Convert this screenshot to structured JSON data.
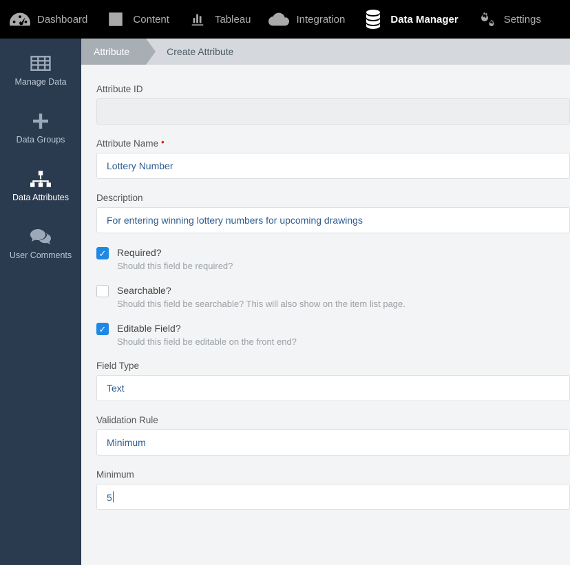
{
  "topnav": {
    "items": [
      {
        "label": "Dashboard",
        "icon": "gauge-icon",
        "active": false
      },
      {
        "label": "Content",
        "icon": "list-box-icon",
        "active": false
      },
      {
        "label": "Tableau",
        "icon": "bar-chart-icon",
        "active": false
      },
      {
        "label": "Integration",
        "icon": "cloud-icon",
        "active": false
      },
      {
        "label": "Data Manager",
        "icon": "database-icon",
        "active": true
      },
      {
        "label": "Settings",
        "icon": "gears-icon",
        "active": false
      }
    ]
  },
  "sidebar": {
    "items": [
      {
        "label": "Manage Data",
        "icon": "grid-icon",
        "active": false
      },
      {
        "label": "Data Groups",
        "icon": "plus-icon",
        "active": false
      },
      {
        "label": "Data Attributes",
        "icon": "hierarchy-icon",
        "active": true
      },
      {
        "label": "User Comments",
        "icon": "comments-icon",
        "active": false
      }
    ]
  },
  "breadcrumb": {
    "first": "Attribute",
    "second": "Create Attribute"
  },
  "form": {
    "attribute_id": {
      "label": "Attribute ID",
      "value": ""
    },
    "attribute_name": {
      "label": "Attribute Name",
      "required": true,
      "value": "Lottery Number"
    },
    "description": {
      "label": "Description",
      "value": "For entering winning lottery numbers for upcoming drawings"
    },
    "required": {
      "label": "Required?",
      "desc": "Should this field be required?",
      "checked": true
    },
    "searchable": {
      "label": "Searchable?",
      "desc": "Should this field be searchable? This will also show on the item list page.",
      "checked": false
    },
    "editable": {
      "label": "Editable Field?",
      "desc": "Should this field be editable on the front end?",
      "checked": true
    },
    "field_type": {
      "label": "Field Type",
      "value": "Text"
    },
    "validation_rule": {
      "label": "Validation Rule",
      "value": "Minimum"
    },
    "minimum": {
      "label": "Minimum",
      "value": "5"
    }
  }
}
